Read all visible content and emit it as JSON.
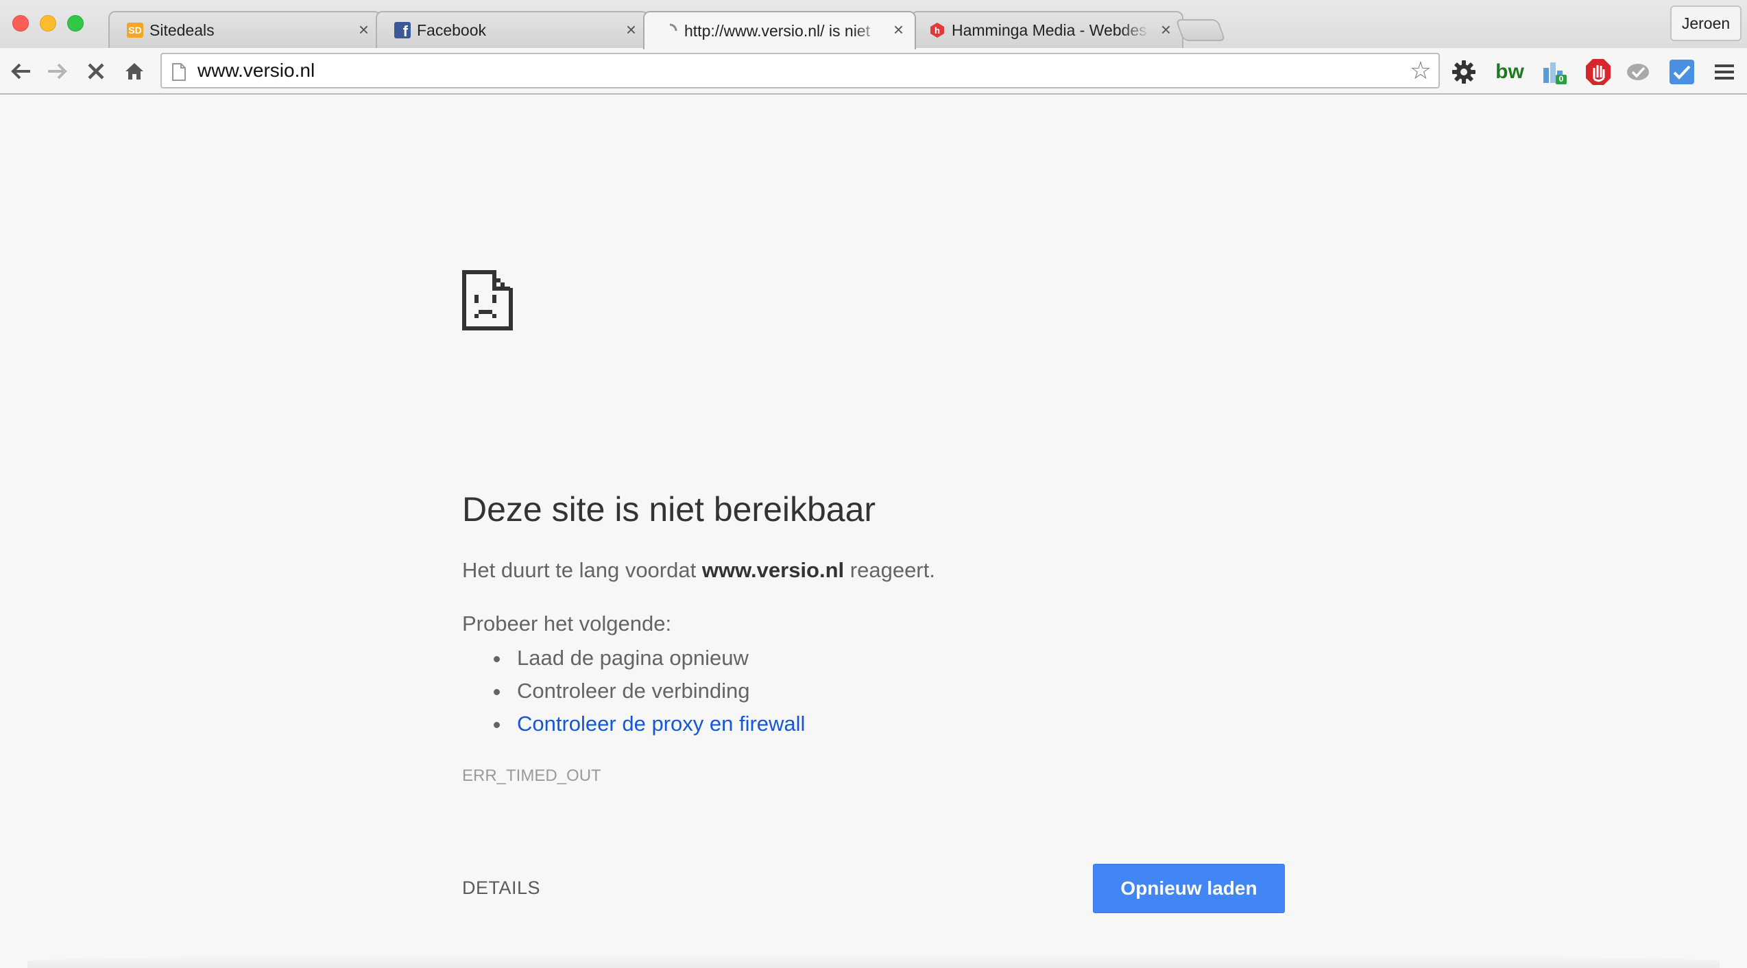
{
  "browser": {
    "tabs": [
      {
        "label": "Sitedeals",
        "favicon": "sitedeals-icon"
      },
      {
        "label": "Facebook",
        "favicon": "facebook-icon"
      },
      {
        "label": "http://www.versio.nl/ is niet",
        "favicon": "loading-spinner-icon"
      },
      {
        "label": "Hamminga Media - Webdes",
        "favicon": "hamminga-icon"
      }
    ],
    "profile_name": "Jeroen",
    "url": "www.versio.nl",
    "sitedeals_badge": "SD",
    "extension_bw_label": "bw",
    "extension_badge_count": "0"
  },
  "error_page": {
    "heading": "Deze site is niet bereikbaar",
    "summary_prefix": "Het duurt te lang voordat",
    "summary_host": "www.versio.nl",
    "summary_suffix": "reageert.",
    "suggestions_heading": "Probeer het volgende:",
    "suggestions": [
      "Laad de pagina opnieuw",
      "Controleer de verbinding",
      "Controleer de proxy en firewall"
    ],
    "error_code": "ERR_TIMED_OUT",
    "details_label": "DETAILS",
    "reload_label": "Opnieuw laden"
  },
  "colors": {
    "accent": "#4285f4",
    "link": "#1558d6",
    "text": "#646464",
    "heading": "#333333"
  }
}
